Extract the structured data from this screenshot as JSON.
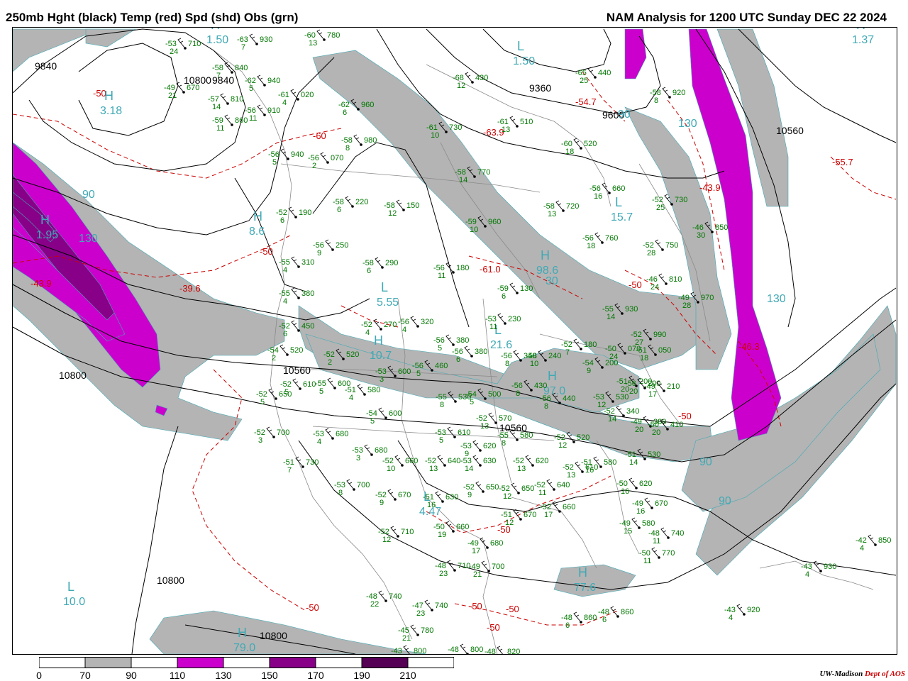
{
  "header": {
    "left_title": "250mb Hght (black) Temp (red) Spd (shd) Obs (grn)",
    "right_title": "NAM Analysis for 1200 UTC Sunday  DEC 22 2024"
  },
  "colors": {
    "height_contour": "#000000",
    "temperature": "#cc0000",
    "observation": "#007700",
    "speed_label": "#3fa9b5",
    "shade_70_90": "#b4b4b4",
    "shade_110_130": "#cc00cc",
    "shade_150_170": "#880088",
    "shade_190_210": "#550055"
  },
  "legend": {
    "ticks": [
      "0",
      "70",
      "90",
      "110",
      "130",
      "150",
      "170",
      "190",
      "210"
    ],
    "fills": [
      "#ffffff",
      "#b4b4b4",
      "#ffffff",
      "#cc00cc",
      "#ffffff",
      "#880088",
      "#ffffff",
      "#550055",
      "#ffffff"
    ]
  },
  "height_labels": [
    "9840",
    "9840",
    "9360",
    "9600",
    "10560",
    "10800",
    "10560",
    "10560",
    "10800",
    "10800",
    "10800"
  ],
  "temp_labels": [
    "-50",
    "-60",
    "-50",
    "-43.9",
    "-39.6",
    "-63.9",
    "-54.7",
    "-61.0",
    "-55.7",
    "-43.9",
    "-50",
    "-46.3",
    "-50",
    "-50",
    "-50",
    "-50",
    "-50",
    "-50"
  ],
  "speed_labels": [
    "30",
    "130",
    "90",
    "90",
    "90",
    "90",
    "130",
    "130"
  ],
  "centers": [
    {
      "kind": "H",
      "value": "3.18"
    },
    {
      "kind": "H",
      "value": "1.50"
    },
    {
      "kind": "L",
      "value": "1.50"
    },
    {
      "kind": "H",
      "value": "1.37"
    },
    {
      "kind": "H",
      "value": "1.95"
    },
    {
      "kind": "H",
      "value": "8.6"
    },
    {
      "kind": "L",
      "value": "15.7"
    },
    {
      "kind": "L",
      "value": "5.55"
    },
    {
      "kind": "H",
      "value": "98.6"
    },
    {
      "kind": "H",
      "value": "10.7"
    },
    {
      "kind": "L",
      "value": "21.6"
    },
    {
      "kind": "H",
      "value": "97.0"
    },
    {
      "kind": "L",
      "value": "4.47"
    },
    {
      "kind": "L",
      "value": "10.0"
    },
    {
      "kind": "H",
      "value": "77.6"
    },
    {
      "kind": "H",
      "value": "79.0"
    }
  ],
  "observations": [
    {
      "t": "-53",
      "h": "710",
      "d": "24"
    },
    {
      "t": "-63",
      "h": "930",
      "d": "7"
    },
    {
      "t": "-60",
      "h": "780",
      "d": "13"
    },
    {
      "t": "-58",
      "h": "840",
      "d": "7"
    },
    {
      "t": "-49",
      "h": "670",
      "d": "21"
    },
    {
      "t": "-62",
      "h": "940",
      "d": "5"
    },
    {
      "t": "-57",
      "h": "810",
      "d": "14"
    },
    {
      "t": "-61",
      "h": "020",
      "d": "4"
    },
    {
      "t": "-56",
      "h": "910",
      "d": "11"
    },
    {
      "t": "-59",
      "h": "860",
      "d": "11"
    },
    {
      "t": "-62",
      "h": "960",
      "d": "6"
    },
    {
      "t": "-58",
      "h": "980",
      "d": "8"
    },
    {
      "t": "-56",
      "h": "940",
      "d": "5"
    },
    {
      "t": "-56",
      "h": "070",
      "d": "2"
    },
    {
      "t": "-65",
      "h": "440",
      "d": "25"
    },
    {
      "t": "-58",
      "h": "920",
      "d": "8"
    },
    {
      "t": "-68",
      "h": "430",
      "d": "12"
    },
    {
      "t": "-61",
      "h": "510",
      "d": "13"
    },
    {
      "t": "-61",
      "h": "730",
      "d": "10"
    },
    {
      "t": "-60",
      "h": "520",
      "d": "18"
    },
    {
      "t": "-58",
      "h": "770",
      "d": "14"
    },
    {
      "t": "-56",
      "h": "660",
      "d": "16"
    },
    {
      "t": "-58",
      "h": "720",
      "d": "13"
    },
    {
      "t": "-52",
      "h": "730",
      "d": "25"
    },
    {
      "t": "-52",
      "h": "190",
      "d": "6"
    },
    {
      "t": "-58",
      "h": "220",
      "d": "6"
    },
    {
      "t": "-58",
      "h": "150",
      "d": "12"
    },
    {
      "t": "-59",
      "h": "960",
      "d": "10"
    },
    {
      "t": "-56",
      "h": "760",
      "d": "18"
    },
    {
      "t": "-52",
      "h": "750",
      "d": "28"
    },
    {
      "t": "-46",
      "h": "850",
      "d": "30"
    },
    {
      "t": "-56",
      "h": "250",
      "d": "9"
    },
    {
      "t": "-58",
      "h": "290",
      "d": "6"
    },
    {
      "t": "-55",
      "h": "310",
      "d": "4"
    },
    {
      "t": "-56",
      "h": "180",
      "d": "11"
    },
    {
      "t": "-59",
      "h": "130",
      "d": "6"
    },
    {
      "t": "-46",
      "h": "810",
      "d": "24"
    },
    {
      "t": "-49",
      "h": "970",
      "d": "28"
    },
    {
      "t": "-55",
      "h": "380",
      "d": "4"
    },
    {
      "t": "-55",
      "h": "930",
      "d": "14"
    },
    {
      "t": "-52",
      "h": "450",
      "d": "6"
    },
    {
      "t": "-52",
      "h": "270",
      "d": "4"
    },
    {
      "t": "-56",
      "h": "320",
      "d": "4"
    },
    {
      "t": "-53",
      "h": "230",
      "d": "11"
    },
    {
      "t": "-52",
      "h": "990",
      "d": "27"
    },
    {
      "t": "-54",
      "h": "520",
      "d": "2"
    },
    {
      "t": "-52",
      "h": "520",
      "d": "2"
    },
    {
      "t": "-56",
      "h": "380",
      "d": "5"
    },
    {
      "t": "-56",
      "h": "380",
      "d": "6"
    },
    {
      "t": "-56",
      "h": "340",
      "d": "8"
    },
    {
      "t": "-58",
      "h": "240",
      "d": "10"
    },
    {
      "t": "-52",
      "h": "180",
      "d": "7"
    },
    {
      "t": "-54",
      "h": "200",
      "d": "9"
    },
    {
      "t": "-50",
      "h": "070",
      "d": "24"
    },
    {
      "t": "-51",
      "h": "050",
      "d": "18"
    },
    {
      "t": "-53",
      "h": "600",
      "d": "3"
    },
    {
      "t": "-56",
      "h": "460",
      "d": "5"
    },
    {
      "t": "-52",
      "h": "610",
      "d": "5"
    },
    {
      "t": "-55",
      "h": "600",
      "d": "5"
    },
    {
      "t": "-51",
      "h": "580",
      "d": "4"
    },
    {
      "t": "-56",
      "h": "430",
      "d": "8"
    },
    {
      "t": "-56",
      "h": "440",
      "d": "8"
    },
    {
      "t": "-53",
      "h": "530",
      "d": "12"
    },
    {
      "t": "-51",
      "h": "200",
      "d": "20"
    },
    {
      "t": "-56",
      "h": "200",
      "d": "20"
    },
    {
      "t": "-49",
      "h": "210",
      "d": "17"
    },
    {
      "t": "-52",
      "h": "650",
      "d": "5"
    },
    {
      "t": "-55",
      "h": "530",
      "d": "8"
    },
    {
      "t": "-54",
      "h": "500",
      "d": "5"
    },
    {
      "t": "-54",
      "h": "600",
      "d": "5"
    },
    {
      "t": "-52",
      "h": "570",
      "d": "13"
    },
    {
      "t": "-52",
      "h": "340",
      "d": "14"
    },
    {
      "t": "-49",
      "h": "380",
      "d": "20"
    },
    {
      "t": "-50",
      "h": "410",
      "d": "20"
    },
    {
      "t": "-52",
      "h": "700",
      "d": "3"
    },
    {
      "t": "-53",
      "h": "680",
      "d": "4"
    },
    {
      "t": "-53",
      "h": "610",
      "d": "5"
    },
    {
      "t": "-55",
      "h": "580",
      "d": "8"
    },
    {
      "t": "-53",
      "h": "620",
      "d": "9"
    },
    {
      "t": "-53",
      "h": "680",
      "d": "3"
    },
    {
      "t": "-52",
      "h": "520",
      "d": "12"
    },
    {
      "t": "-51",
      "h": "530",
      "d": "14"
    },
    {
      "t": "-51",
      "h": "730",
      "d": "7"
    },
    {
      "t": "-52",
      "h": "660",
      "d": "10"
    },
    {
      "t": "-52",
      "h": "640",
      "d": "13"
    },
    {
      "t": "-53",
      "h": "630",
      "d": "14"
    },
    {
      "t": "-52",
      "h": "620",
      "d": "13"
    },
    {
      "t": "-52",
      "h": "610",
      "d": "13"
    },
    {
      "t": "-51",
      "h": "580",
      "d": "16"
    },
    {
      "t": "-50",
      "h": "620",
      "d": "16"
    },
    {
      "t": "-53",
      "h": "700",
      "d": "8"
    },
    {
      "t": "-52",
      "h": "670",
      "d": "9"
    },
    {
      "t": "-51",
      "h": "630",
      "d": "16"
    },
    {
      "t": "-52",
      "h": "650",
      "d": "9"
    },
    {
      "t": "-52",
      "h": "650",
      "d": "12"
    },
    {
      "t": "-52",
      "h": "640",
      "d": "11"
    },
    {
      "t": "-49",
      "h": "670",
      "d": "16"
    },
    {
      "t": "-52",
      "h": "710",
      "d": "12"
    },
    {
      "t": "-50",
      "h": "660",
      "d": "19"
    },
    {
      "t": "-51",
      "h": "670",
      "d": "12"
    },
    {
      "t": "-52",
      "h": "660",
      "d": "17"
    },
    {
      "t": "-49",
      "h": "580",
      "d": "15"
    },
    {
      "t": "-48",
      "h": "740",
      "d": "11"
    },
    {
      "t": "-49",
      "h": "680",
      "d": "17"
    },
    {
      "t": "-50",
      "h": "770",
      "d": "11"
    },
    {
      "t": "-42",
      "h": "850",
      "d": "4"
    },
    {
      "t": "-48",
      "h": "710",
      "d": "23"
    },
    {
      "t": "-49",
      "h": "700",
      "d": "21"
    },
    {
      "t": "-43",
      "h": "930",
      "d": "4"
    },
    {
      "t": "-48",
      "h": "740",
      "d": "22"
    },
    {
      "t": "-47",
      "h": "740",
      "d": "23"
    },
    {
      "t": "-43",
      "h": "920",
      "d": "4"
    },
    {
      "t": "-48",
      "h": "860",
      "d": "6"
    },
    {
      "t": "-48",
      "h": "860",
      "d": "6"
    },
    {
      "t": "-45",
      "h": "780",
      "d": "21"
    },
    {
      "t": "-43",
      "h": "800",
      "d": "8"
    },
    {
      "t": "-48",
      "h": "800",
      "d": "6"
    },
    {
      "t": "-48",
      "h": "820",
      "d": "2"
    }
  ],
  "credit": {
    "org": "UW-Madison",
    "dept": "Dept of AOS"
  }
}
